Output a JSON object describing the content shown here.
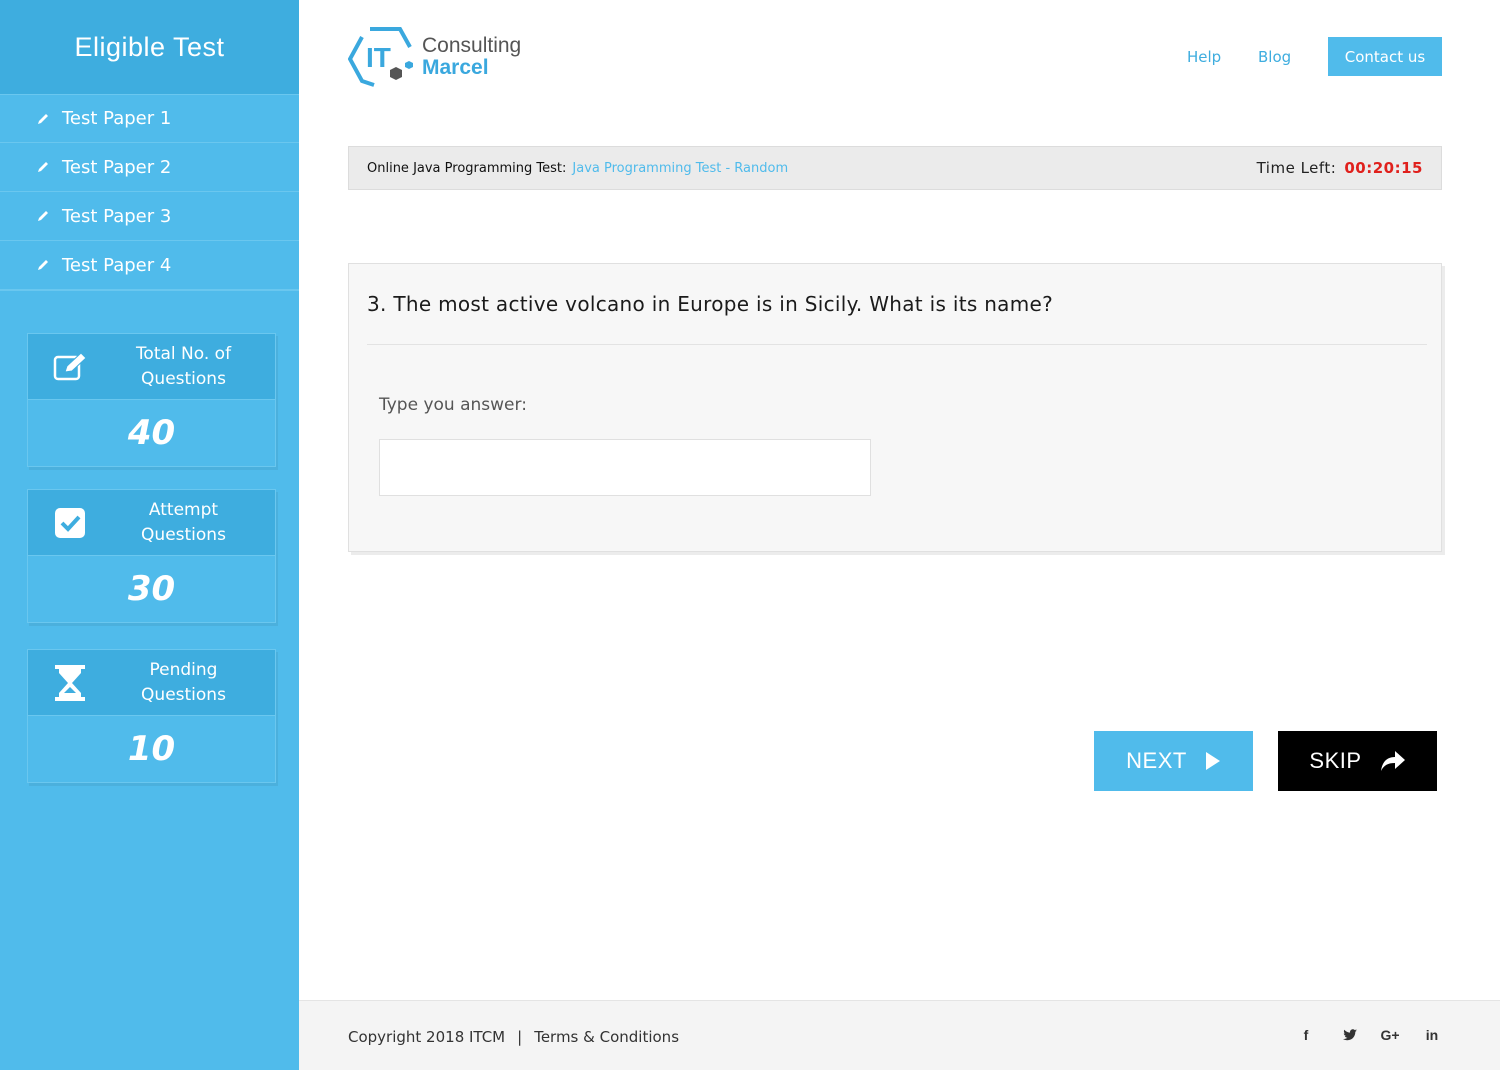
{
  "sidebar": {
    "title": "Eligible Test",
    "items": [
      {
        "label": "Test Paper 1",
        "icon": "pencil-icon"
      },
      {
        "label": "Test Paper 2",
        "icon": "pencil-icon"
      },
      {
        "label": "Test Paper 3",
        "icon": "pencil-icon"
      },
      {
        "label": "Test Paper 4",
        "icon": "pencil-icon"
      }
    ],
    "stats": [
      {
        "label": "Total No. of Questions",
        "value": "40",
        "icon": "edit-icon"
      },
      {
        "label": "Attempt Questions",
        "value": "30",
        "icon": "checkbox-icon"
      },
      {
        "label": "Pending Questions",
        "value": "10",
        "icon": "hourglass-icon"
      }
    ]
  },
  "header": {
    "logo": {
      "mark": "IT",
      "line1": "Consulting",
      "line2": "Marcel"
    },
    "nav": {
      "help": "Help",
      "blog": "Blog",
      "contact": "Contact us"
    }
  },
  "test_bar": {
    "label": "Online Java Programming Test:",
    "test_name": "Java Programming Test - Random",
    "time_label": "Time Left:",
    "time_value": "00:20:15"
  },
  "question": {
    "text": "3. The most active volcano in Europe is in Sicily. What is its name?",
    "prompt": "Type you answer:",
    "answer_value": "",
    "answer_placeholder": ""
  },
  "actions": {
    "next": "NEXT",
    "skip": "SKIP"
  },
  "footer": {
    "copyright": "Copyright 2018 ITCM",
    "separator": "|",
    "terms": "Terms & Conditions",
    "social": [
      {
        "glyph": "f",
        "icon": "facebook-icon"
      },
      {
        "glyph": "t",
        "icon": "twitter-icon"
      },
      {
        "glyph": "G+",
        "icon": "google-plus-icon"
      },
      {
        "glyph": "in",
        "icon": "linkedin-icon"
      }
    ]
  },
  "colors": {
    "sidebar_bg": "#50bbeb",
    "sidebar_header": "#3eaddf",
    "accent": "#50bbeb",
    "timer": "#e0201c",
    "skip_bg": "#000000"
  }
}
